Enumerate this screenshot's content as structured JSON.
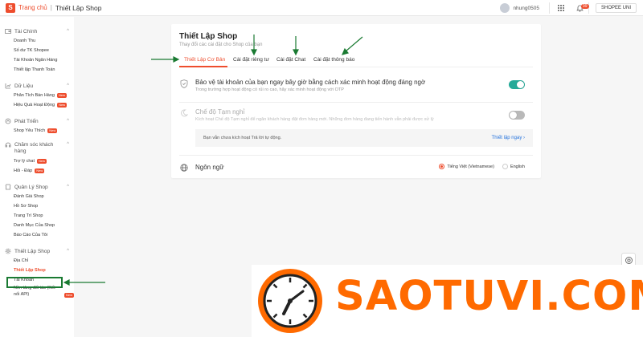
{
  "header": {
    "home": "Trang chủ",
    "separator": "|",
    "current": "Thiết Lập Shop",
    "username": "nhung0505",
    "notification_count": "99",
    "shop_button": "SHOPEE UNI"
  },
  "sidebar": {
    "new_badge": "New",
    "sections": [
      {
        "title": "Tài Chính",
        "icon": "wallet-icon",
        "items": [
          "Doanh Thu",
          "Số dư TK Shopee",
          "Tài Khoản Ngân Hàng",
          "Thiết lập Thanh Toán"
        ]
      },
      {
        "title": "Dữ Liệu",
        "icon": "chart-icon",
        "items": [
          "Phân Tích Bán Hàng",
          "Hiệu Quả Hoạt Động"
        ]
      },
      {
        "title": "Phát Triển",
        "icon": "growth-icon",
        "items": [
          "Shop Yêu Thích"
        ]
      },
      {
        "title": "Chăm sóc khách hàng",
        "icon": "support-icon",
        "items": [
          "Trợ lý chat",
          "Hỏi - Đáp"
        ]
      },
      {
        "title": "Quản Lý Shop",
        "icon": "store-icon",
        "items": [
          "Đánh Giá Shop",
          "Hồ Sơ Shop",
          "Trang Trí Shop",
          "Danh Mục Của Shop",
          "Báo Cáo Của Tôi"
        ]
      },
      {
        "title": "Thiết Lập Shop",
        "icon": "settings-icon",
        "items": [
          "Địa Chỉ",
          "Thiết Lập Shop",
          "Tài Khoản",
          "Nền tảng đối tác (Kết nối API)"
        ]
      }
    ]
  },
  "card": {
    "title": "Thiết Lập Shop",
    "subtitle": "Thay đổi các cài đặt cho Shop của bạn",
    "tabs": [
      "Thiết Lập Cơ Bản",
      "Cài đặt riêng tư",
      "Cài đặt Chat",
      "Cài đặt thông báo"
    ],
    "security": {
      "title": "Bảo vệ tài khoản của bạn ngay bây giờ bằng cách xác minh hoạt động đáng ngờ",
      "desc": "Trong trường hợp hoạt động có rủi ro cao, hãy xác minh hoạt động với OTP",
      "enabled": true
    },
    "vacation": {
      "title": "Chế độ Tạm nghỉ",
      "desc": "Kích hoạt Chế độ Tạm nghỉ để ngăn khách hàng đặt đơn hàng mới. Những đơn hàng đang tiến hành vẫn phải được xử lý",
      "enabled": false,
      "notice": "Bạn vẫn chưa kích hoạt Trả lời tự động.",
      "notice_link": "Thiết lập ngay"
    },
    "language": {
      "title": "Ngôn ngữ",
      "options": [
        "Tiếng Việt (Vietnamese)",
        "English"
      ],
      "selected": "Tiếng Việt (Vietnamese)"
    }
  },
  "watermark": {
    "text": "SAOTUVI.COM"
  },
  "colors": {
    "accent": "#ee4d2d",
    "toggle_on": "#26aa99",
    "annotation": "#1a7a32",
    "watermark": "#ff6a00"
  }
}
